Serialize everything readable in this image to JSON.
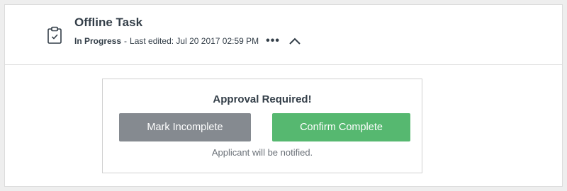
{
  "task": {
    "title": "Offline Task",
    "icon": "clipboard-check-icon",
    "status": "In Progress",
    "separator": "-",
    "last_edited": "Last edited: Jul 20 2017 02:59 PM",
    "more_icon": "•••",
    "collapse_icon": "chevron-up-icon"
  },
  "approval": {
    "title": "Approval Required!",
    "mark_incomplete_label": "Mark Incomplete",
    "confirm_complete_label": "Confirm Complete",
    "notice": "Applicant will be notified."
  },
  "colors": {
    "incomplete_button": "#858a90",
    "confirm_button": "#56b870",
    "text": "#333e48"
  }
}
